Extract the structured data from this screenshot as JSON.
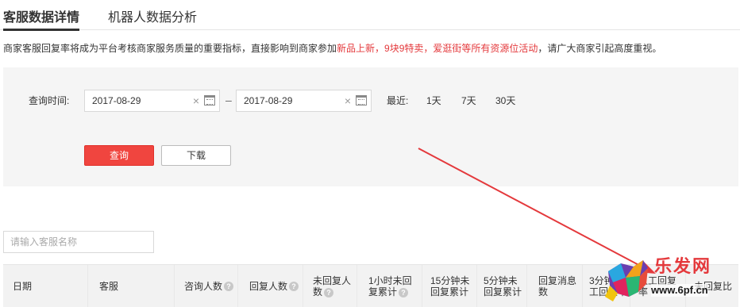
{
  "tabs": {
    "active": "客服数据详情",
    "inactive": "机器人数据分析"
  },
  "notice": {
    "prefix": "商家客服回复率将成为平台考核商家服务质量的重要指标，直接影响到商家参加",
    "highlight": "新品上新，9块9特卖，爱逛街等所有资源位活动",
    "suffix": "，请广大商家引起高度重视。",
    "highlight_color": "#e4393c"
  },
  "filter": {
    "query_time_label": "查询时间:",
    "start_date": "2017-08-29",
    "end_date": "2017-08-29",
    "clear_glyph": "×",
    "range_sep": "–",
    "recent_label": "最近:",
    "quick_ranges": [
      "1天",
      "7天",
      "30天"
    ],
    "query_button": "查询",
    "download_button": "下载"
  },
  "search": {
    "placeholder": "请输入客服名称"
  },
  "table": {
    "columns": [
      {
        "label": "日期",
        "help": false
      },
      {
        "label": "客服",
        "help": false
      },
      {
        "label": "咨询人数",
        "help": true
      },
      {
        "label": "回复人数",
        "help": true
      },
      {
        "label": "未回复人数",
        "help": true
      },
      {
        "label": "1小时未回复累计",
        "help": true
      },
      {
        "label": "15分钟未回复累计",
        "help": false
      },
      {
        "label": "5分钟未回复累计",
        "help": false
      },
      {
        "label": "回复消息数",
        "help": false
      },
      {
        "label": "3分钟人工回复率",
        "help": false
      },
      {
        "label": "人工回复率",
        "help": false
      },
      {
        "label": "未回复比",
        "help": false
      }
    ],
    "help_glyph": "?"
  },
  "watermark": {
    "title": "乐发网",
    "url": "www.6pf.cn"
  },
  "colors": {
    "accent_red": "#f0453f",
    "arrow_red": "#e4393c"
  }
}
